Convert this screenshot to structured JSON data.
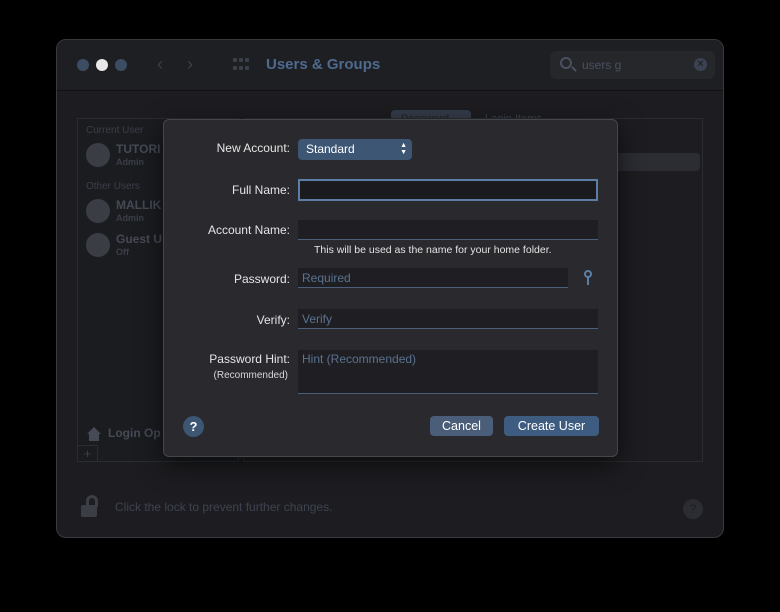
{
  "window": {
    "title": "Users & Groups",
    "search_value": "users g"
  },
  "tabs": [
    "Password",
    "Login Items"
  ],
  "sidebar": {
    "current_user_label": "Current User",
    "other_users_label": "Other Users",
    "users": [
      {
        "name": "TUTORI",
        "role": "Admin"
      },
      {
        "name": "MALLIK",
        "role": "Admin"
      },
      {
        "name": "Guest U",
        "role": "Off"
      }
    ],
    "login_options": "Login Op",
    "add_button": "+"
  },
  "lock_text": "Click the lock to prevent further changes.",
  "sheet": {
    "new_account_label": "New Account:",
    "new_account_value": "Standard",
    "full_name_label": "Full Name:",
    "full_name_value": "",
    "account_name_label": "Account Name:",
    "account_name_value": "",
    "account_name_note": "This will be used as the name for your home folder.",
    "password_label": "Password:",
    "password_placeholder": "Required",
    "verify_label": "Verify:",
    "verify_placeholder": "Verify",
    "hint_label": "Password Hint:",
    "hint_sublabel": "(Recommended)",
    "hint_placeholder": "Hint (Recommended)",
    "help": "?",
    "cancel": "Cancel",
    "create": "Create User"
  }
}
